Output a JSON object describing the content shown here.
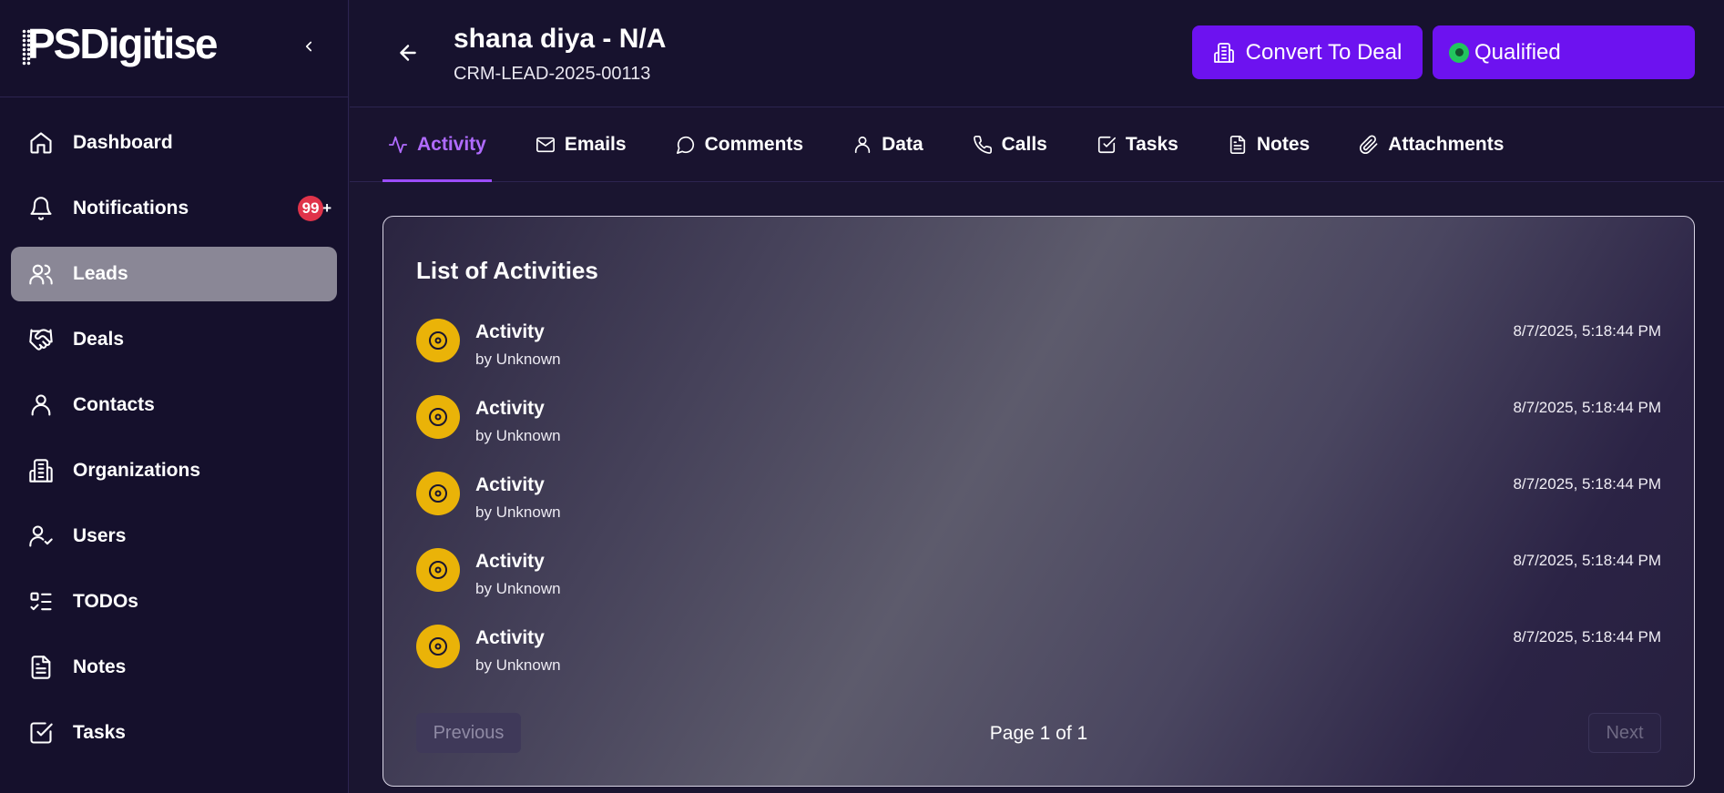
{
  "brand": {
    "logo_text": "PSDigitise"
  },
  "sidebar": {
    "items": [
      {
        "label": "Dashboard",
        "icon": "home-icon"
      },
      {
        "label": "Notifications",
        "icon": "bell-icon",
        "badge": "99",
        "badge_suffix": "+"
      },
      {
        "label": "Leads",
        "icon": "users-icon",
        "active": true
      },
      {
        "label": "Deals",
        "icon": "handshake-icon"
      },
      {
        "label": "Contacts",
        "icon": "user-icon"
      },
      {
        "label": "Organizations",
        "icon": "building-icon"
      },
      {
        "label": "Users",
        "icon": "user-check-icon"
      },
      {
        "label": "TODOs",
        "icon": "list-todo-icon"
      },
      {
        "label": "Notes",
        "icon": "file-text-icon"
      },
      {
        "label": "Tasks",
        "icon": "square-check-icon"
      }
    ]
  },
  "header": {
    "title": "shana diya - N/A",
    "lead_id": "CRM-LEAD-2025-00113",
    "convert_label": "Convert To Deal",
    "status_label": "Qualified"
  },
  "tabs": [
    {
      "label": "Activity",
      "icon": "activity-icon",
      "active": true
    },
    {
      "label": "Emails",
      "icon": "mail-icon"
    },
    {
      "label": "Comments",
      "icon": "message-icon"
    },
    {
      "label": "Data",
      "icon": "user-icon"
    },
    {
      "label": "Calls",
      "icon": "phone-icon"
    },
    {
      "label": "Tasks",
      "icon": "square-check-icon"
    },
    {
      "label": "Notes",
      "icon": "file-text-icon"
    },
    {
      "label": "Attachments",
      "icon": "paperclip-icon"
    }
  ],
  "activities": {
    "title": "List of Activities",
    "items": [
      {
        "name": "Activity",
        "by": "by Unknown",
        "time": "8/7/2025, 5:18:44 PM"
      },
      {
        "name": "Activity",
        "by": "by Unknown",
        "time": "8/7/2025, 5:18:44 PM"
      },
      {
        "name": "Activity",
        "by": "by Unknown",
        "time": "8/7/2025, 5:18:44 PM"
      },
      {
        "name": "Activity",
        "by": "by Unknown",
        "time": "8/7/2025, 5:18:44 PM"
      },
      {
        "name": "Activity",
        "by": "by Unknown",
        "time": "8/7/2025, 5:18:44 PM"
      }
    ],
    "pagination": {
      "prev_label": "Previous",
      "next_label": "Next",
      "page_info": "Page 1 of 1"
    }
  },
  "colors": {
    "accent": "#6d12f0",
    "tab_active": "#b06bff",
    "badge": "#e0334a",
    "activity_icon": "#eab308",
    "status_dot": "#22c55e"
  }
}
